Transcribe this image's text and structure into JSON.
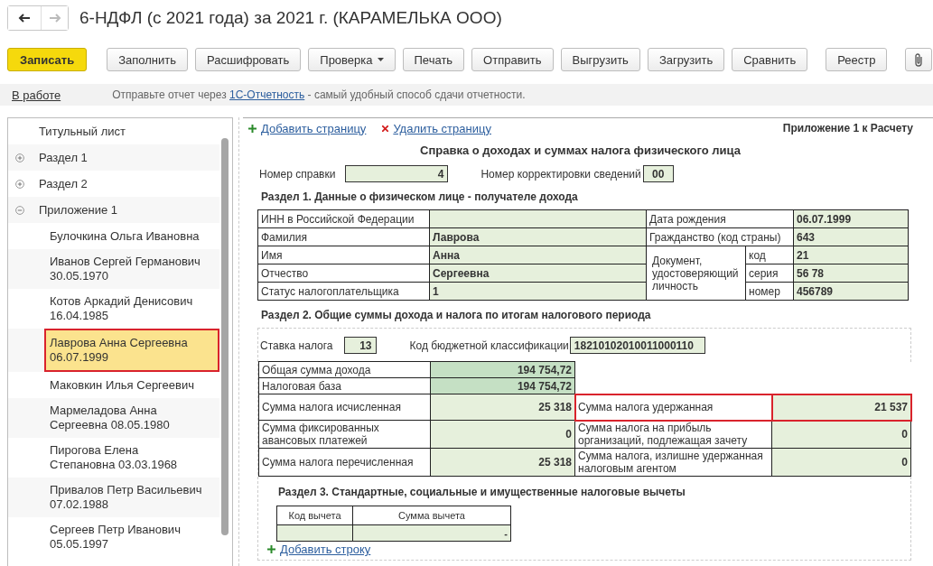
{
  "window": {
    "title": "6-НДФЛ (с 2021 года) за 2021 г. (КАРАМЕЛЬКА ООО)"
  },
  "toolbar": [
    {
      "label": "Записать",
      "kind": "primary"
    },
    {
      "label": "Заполнить",
      "kind": "plain"
    },
    {
      "label": "Расшифровать",
      "kind": "plain"
    },
    {
      "label": "Проверка",
      "kind": "dropdown"
    },
    {
      "label": "Печать",
      "kind": "plain"
    },
    {
      "label": "Отправить",
      "kind": "plain"
    },
    {
      "label": "Выгрузить",
      "kind": "plain"
    },
    {
      "label": "Загрузить",
      "kind": "plain"
    },
    {
      "label": "Сравнить",
      "kind": "plain"
    },
    {
      "label": "Реестр",
      "kind": "plain"
    },
    {
      "kind": "attach"
    }
  ],
  "info_bar": {
    "status": "В работе",
    "text_before": "Отправьте отчет через",
    "link": "1С-Отчетность",
    "text_after": "- самый удобный способ сдачи отчетности."
  },
  "sidebar": {
    "items": [
      {
        "label": "Титульный лист",
        "selected": false
      },
      {
        "label": "Раздел 1",
        "selected": false,
        "expanded": false
      },
      {
        "label": "Раздел 2",
        "selected": false,
        "expanded": false
      },
      {
        "label": "Приложение 1",
        "selected": false,
        "expanded": true,
        "children": [
          {
            "label": "Булочкина Ольга Ивановна",
            "selected": false
          },
          {
            "label": "Иванов Сергей Германович 30.05.1970",
            "selected": false
          },
          {
            "label": "Котов Аркадий Денисович 16.04.1985",
            "selected": false
          },
          {
            "label": "Лаврова Анна Сергеевна 06.07.1999",
            "selected": true
          },
          {
            "label": "Маковкин Илья Сергеевич",
            "selected": false
          },
          {
            "label": "Мармеладова Анна Сергеевна 08.05.1980",
            "selected": false
          },
          {
            "label": "Пирогова Елена Степановна 03.03.1968",
            "selected": false
          },
          {
            "label": "Привалов Петр Васильевич 07.02.1988",
            "selected": false
          },
          {
            "label": "Сергеев Петр Иванович 05.05.1997",
            "selected": false
          }
        ]
      }
    ]
  },
  "document": {
    "add_page": "Добавить страницу",
    "delete_page": "Удалить страницу",
    "appendix": "Приложение 1 к Расчету",
    "heading": "Справка о доходах и суммах налога физического лица",
    "cert_number_label": "Номер справки",
    "cert_number": "4",
    "correction_label": "Номер корректировки сведений",
    "correction": "00",
    "section1": {
      "title": "Раздел 1. Данные о физическом лице - получателе дохода",
      "left": [
        {
          "label": "ИНН в Российской Федерации"
        },
        {
          "label": "Фамилия",
          "value": "Лаврова"
        },
        {
          "label": "Имя",
          "value": "Анна"
        },
        {
          "label": "Отчество",
          "value": "Сергеевна"
        },
        {
          "label": "Статус налогоплательщика",
          "value": "1"
        }
      ],
      "right": [
        {
          "label": "Дата рождения",
          "value": "06.07.1999"
        },
        {
          "label": "Гражданство (код страны)",
          "value": "643"
        }
      ],
      "identity_label": "Документ, удостоверяющий личность",
      "identity": [
        {
          "label": "код",
          "value": "21"
        },
        {
          "label": "серия",
          "value": "56 78"
        },
        {
          "label": "номер",
          "value": "456789"
        }
      ]
    },
    "section2": {
      "title": "Раздел 2. Общие суммы дохода и налога по итогам налогового периода",
      "rate_label": "Ставка налога",
      "rate": "13",
      "kbk_label": "Код бюджетной классификации",
      "kbk": "18210102010011000110",
      "left": [
        {
          "label": "Общая сумма дохода",
          "value": "194 754,72",
          "emphasis": true
        },
        {
          "label": "Налоговая база",
          "value": "194 754,72",
          "emphasis": true
        },
        {
          "label": "Сумма налога исчисленная",
          "value": "25 318",
          "emphasis": false
        },
        {
          "label": "Сумма фиксированных авансовых платежей",
          "value": "0",
          "emphasis": false
        },
        {
          "label": "Сумма налога перечисленная",
          "value": "25 318",
          "emphasis": false
        }
      ],
      "right": [
        {
          "label": "Сумма налога удержанная",
          "value": "21 537",
          "highlighted": true
        },
        {
          "label": "Сумма налога на прибыль организаций, подлежащая зачету",
          "value": "0",
          "highlighted": false
        },
        {
          "label": "Сумма налога, излишне удержанная налоговым агентом",
          "value": "0",
          "highlighted": false
        }
      ]
    },
    "section3": {
      "title": "Раздел 3. Стандартные, социальные и имущественные налоговые вычеты",
      "columns": [
        "Код вычета",
        "Сумма вычета"
      ],
      "rows": [
        [
          "",
          "-"
        ]
      ],
      "add_row": "Добавить строку"
    }
  }
}
